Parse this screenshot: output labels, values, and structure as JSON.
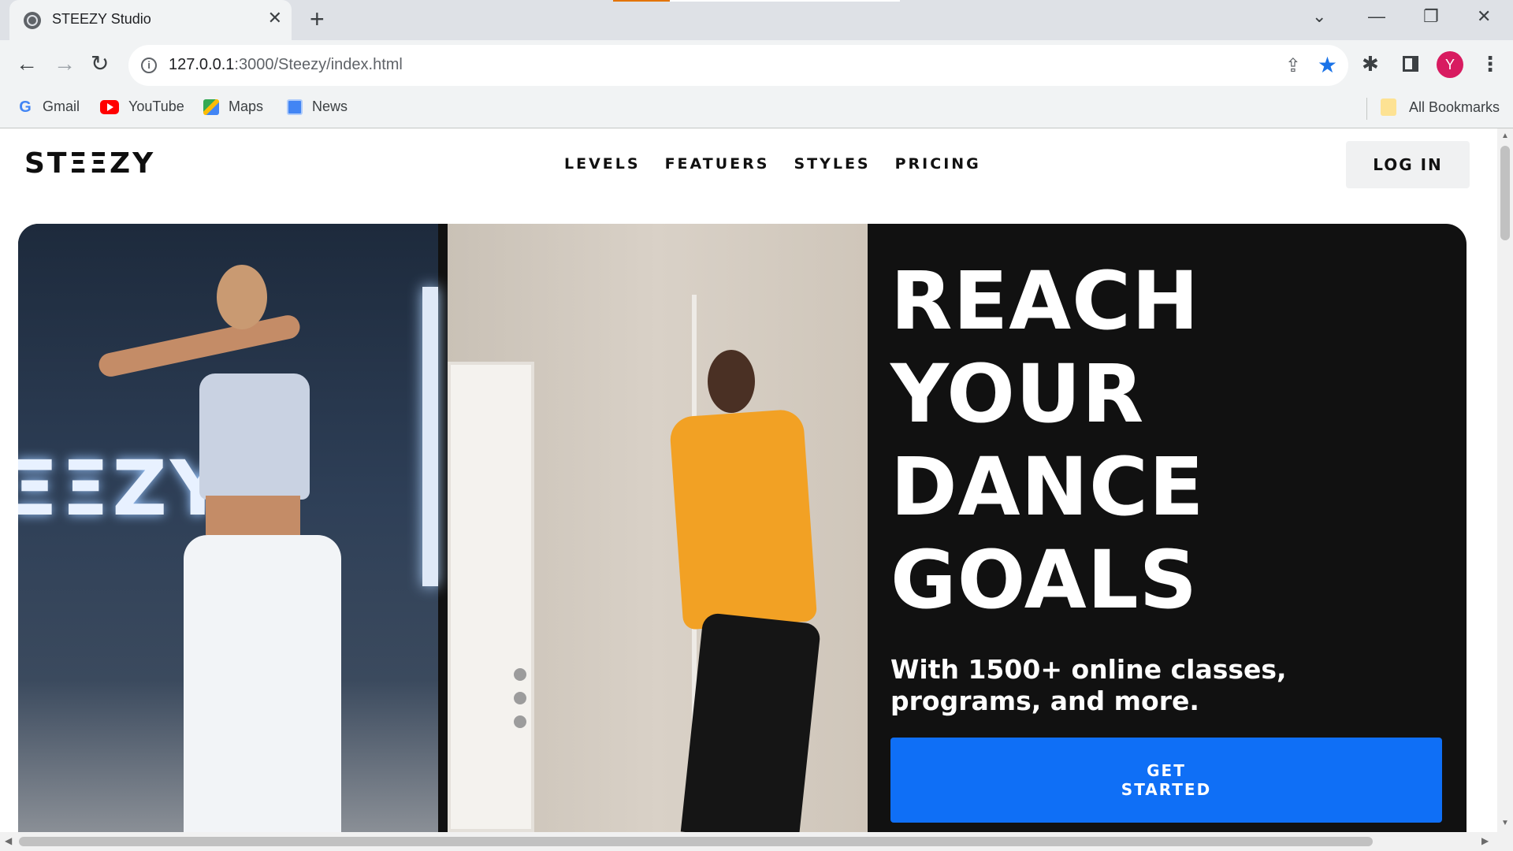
{
  "browser": {
    "tab_title": "STEEZY Studio",
    "tab_close": "✕",
    "new_tab": "+",
    "window_controls": {
      "dropdown": "⌄",
      "minimize": "—",
      "restore": "❐",
      "close": "✕"
    },
    "nav": {
      "back": "←",
      "forward": "→",
      "reload": "↻"
    },
    "url_host": "127.0.0.1",
    "url_path": ":3000/Steezy/index.html",
    "info_icon": "i",
    "share_icon": "⇪",
    "star_icon": "★",
    "extensions_icon": "✱",
    "avatar_letter": "Y",
    "menu_icon": "⋮",
    "bookmarks": [
      {
        "label": "Gmail",
        "icon": "google-icon"
      },
      {
        "label": "YouTube",
        "icon": "youtube-icon"
      },
      {
        "label": "Maps",
        "icon": "maps-icon"
      },
      {
        "label": "News",
        "icon": "news-icon"
      }
    ],
    "all_bookmarks": "All Bookmarks",
    "colors": {
      "accent_star": "#1a73e8",
      "avatar": "#d81b60",
      "progress": "#e37400"
    }
  },
  "site": {
    "logo": "STΞΞZY",
    "nav": [
      "LEVELS",
      "FEATUERS",
      "STYLES",
      "PRICING"
    ],
    "login": "LOG IN",
    "video_brand_text": "ΞΞZY",
    "headline": "REACH YOUR DANCE GOALS",
    "subheadline": "With 1500+ online classes, programs, and more.",
    "cta_line1": "GET",
    "cta_line2": "STARTED",
    "colors": {
      "cta": "#0f6ff6",
      "hero_bg": "#111111"
    }
  },
  "scrollbars": {
    "up": "▲",
    "down": "▼",
    "left": "◀",
    "right": "▶"
  }
}
